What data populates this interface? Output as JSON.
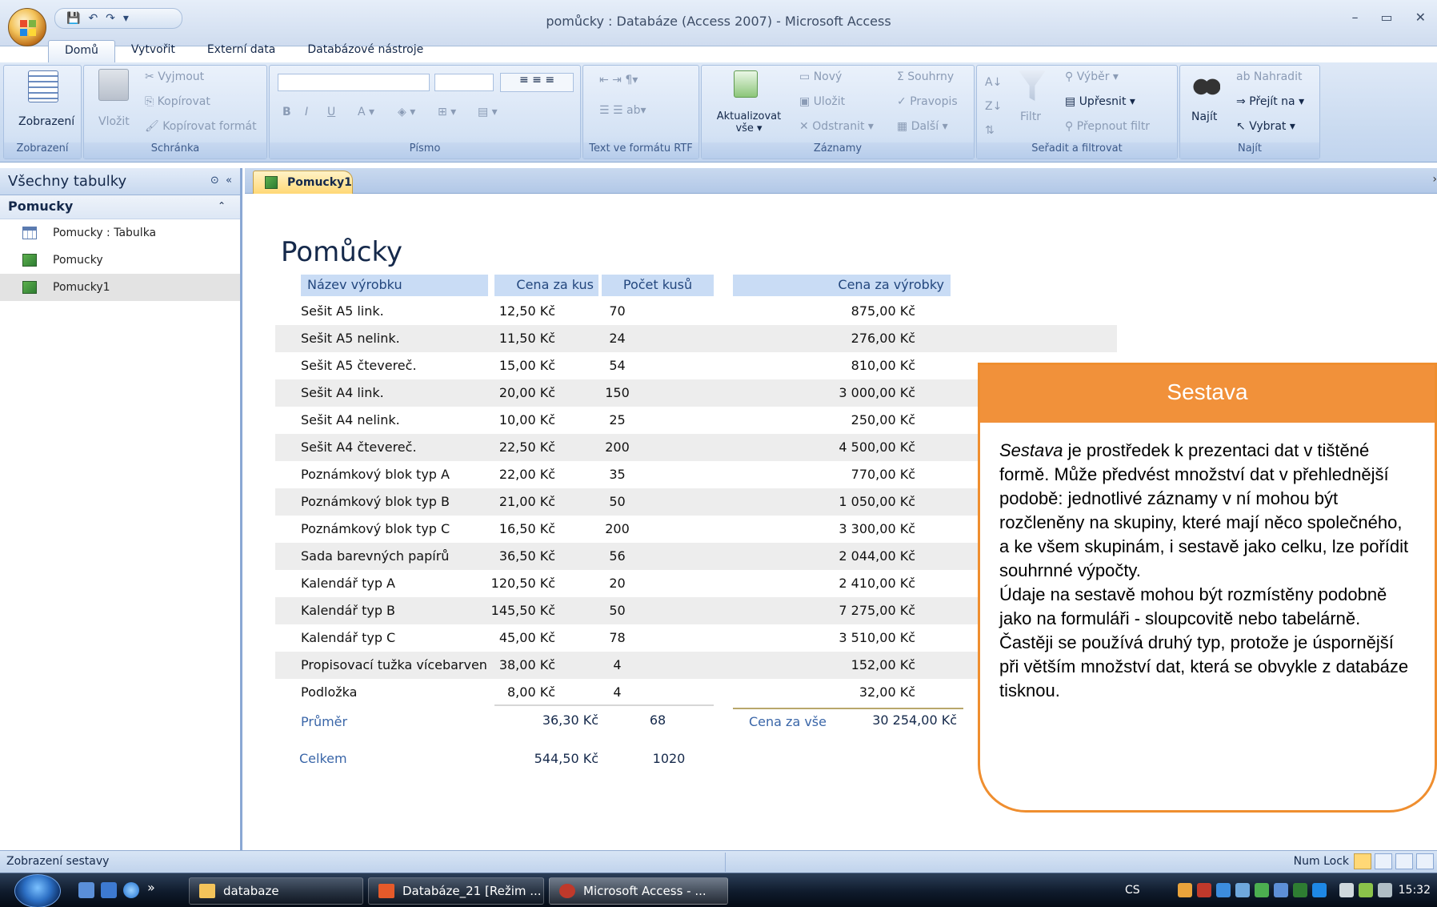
{
  "window": {
    "title": "pomůcky : Databáze (Access 2007) - Microsoft Access",
    "minimize": "–",
    "maximize": "▭",
    "close": "✕"
  },
  "ribbon_tabs": [
    "Domů",
    "Vytvořit",
    "Externí data",
    "Databázové nástroje"
  ],
  "ribbon": {
    "zobrazeni": {
      "button": "Zobrazení",
      "label": "Zobrazení"
    },
    "schranka": {
      "vlozit": "Vložit",
      "vyjmout": "Vyjmout",
      "kopirovat": "Kopírovat",
      "kopirovat_format": "Kopírovat formát",
      "label": "Schránka"
    },
    "pismo": {
      "label": "Písmo",
      "bold": "B",
      "italic": "I",
      "underline": "U"
    },
    "rtf": {
      "label": "Text ve formátu RTF"
    },
    "zaznamy": {
      "aktualizovat": "Aktualizovat",
      "vse": "vše ▾",
      "novy": "Nový",
      "ulozit": "Uložit",
      "odstranit": "Odstranit ▾",
      "souhrny": "Souhrny",
      "pravopis": "Pravopis",
      "dalsi": "Další ▾",
      "label": "Záznamy"
    },
    "filtr": {
      "filtr": "Filtr",
      "vyber": "Výběr ▾",
      "upresnit": "Upřesnit ▾",
      "prepnout": "Přepnout filtr",
      "label": "Seřadit a filtrovat"
    },
    "najit": {
      "najit": "Najít",
      "nahradit": "Nahradit",
      "prejit": "Přejít na ▾",
      "vybrat": "Vybrat ▾",
      "label": "Najít"
    }
  },
  "nav": {
    "header": "Všechny tabulky",
    "group": "Pomucky",
    "items": [
      {
        "label": "Pomucky : Tabulka",
        "type": "table"
      },
      {
        "label": "Pomucky",
        "type": "report"
      },
      {
        "label": "Pomucky1",
        "type": "report"
      }
    ]
  },
  "doc_tab": "Pomucky1",
  "report": {
    "title": "Pomůcky",
    "headers": [
      "Název výrobku",
      "Cena za kus",
      "Počet kusů",
      "Cena za výrobky"
    ],
    "rows": [
      [
        "Sešit A5 link.",
        "12,50 Kč",
        "70",
        "875,00 Kč"
      ],
      [
        "Sešit A5 nelink.",
        "11,50 Kč",
        "24",
        "276,00 Kč"
      ],
      [
        "Sešit A5 čtevereč.",
        "15,00 Kč",
        "54",
        "810,00 Kč"
      ],
      [
        "Sešit A4 link.",
        "20,00 Kč",
        "150",
        "3 000,00 Kč"
      ],
      [
        "Sešit A4 nelink.",
        "10,00 Kč",
        "25",
        "250,00 Kč"
      ],
      [
        "Sešit A4 čtevereč.",
        "22,50 Kč",
        "200",
        "4 500,00 Kč"
      ],
      [
        "Poznámkový blok typ A",
        "22,00 Kč",
        "35",
        "770,00 Kč"
      ],
      [
        "Poznámkový blok typ B",
        "21,00 Kč",
        "50",
        "1 050,00 Kč"
      ],
      [
        "Poznámkový blok typ C",
        "16,50 Kč",
        "200",
        "3 300,00 Kč"
      ],
      [
        "Sada barevných papírů",
        "36,50 Kč",
        "56",
        "2 044,00 Kč"
      ],
      [
        "Kalendář typ A",
        "120,50 Kč",
        "20",
        "2 410,00 Kč"
      ],
      [
        "Kalendář typ B",
        "145,50 Kč",
        "50",
        "7 275,00 Kč"
      ],
      [
        "Kalendář typ C",
        "45,00 Kč",
        "78",
        "3 510,00 Kč"
      ],
      [
        "Propisovací tužka vícebarven",
        "38,00 Kč",
        "4",
        "152,00 Kč"
      ],
      [
        "Podložka",
        "8,00 Kč",
        "4",
        "32,00 Kč"
      ]
    ],
    "avg_label": "Průměr",
    "avg_price": "36,30 Kč",
    "avg_count": "68",
    "total_all_label": "Cena za vše",
    "total_all": "30 254,00 Kč",
    "sum_label": "Celkem",
    "sum_price": "544,50 Kč",
    "sum_count": "1020"
  },
  "callout": {
    "title": "Sestava",
    "term": "Sestava",
    "p1_rest": " je prostředek k prezentaci dat v tištěné formě. Může předvést množství dat v přehlednější podobě: jednotlivé záznamy v ní mohou být rozčleněny na skupiny, které mají něco společného, a ke všem skupinám, i sestavě jako celku, lze pořídit souhrnné výpočty.",
    "p2": "Údaje na sestavě mohou být rozmístěny podobně jako na formuláři - sloupcovitě nebo tabelárně. Častěji se používá druhý typ, protože je úspornější při větším množství dat, která se obvykle z databáze tisknou."
  },
  "status": {
    "left": "Zobrazení sestavy",
    "numlock": "Num Lock"
  },
  "taskbar": {
    "items": [
      "databaze",
      "Databáze_21 [Režim ...",
      "Microsoft Access - ..."
    ],
    "lang": "CS",
    "clock": "15:32",
    "chevron": "»"
  },
  "colors": {
    "accent_orange": "#f1913a",
    "header_blue": "#c9dcf5",
    "ribbon_blue": "#c9daf0"
  }
}
